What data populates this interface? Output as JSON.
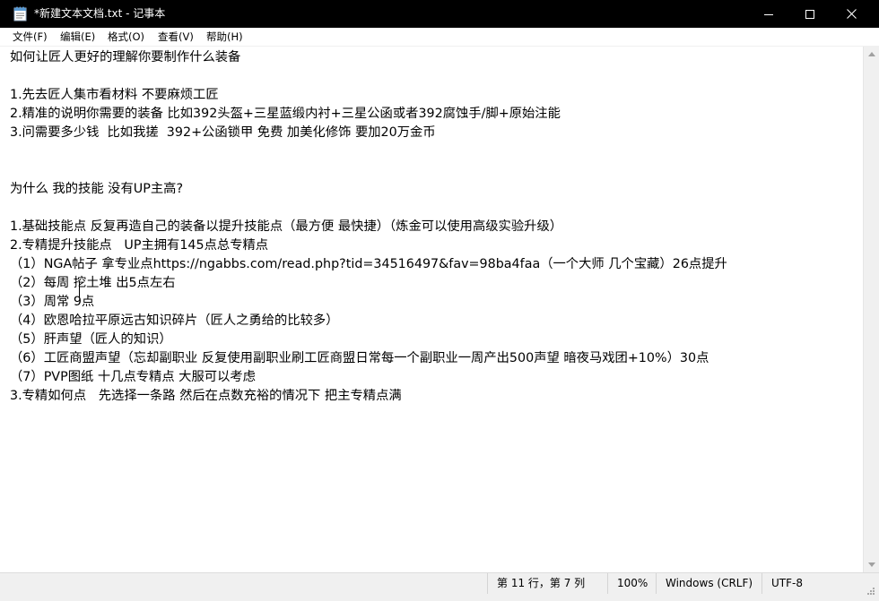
{
  "window": {
    "title": "*新建文本文档.txt - 记事本",
    "icons": {
      "app": "notepad-icon",
      "minimize": "minimize-icon",
      "maximize": "maximize-icon",
      "close": "close-icon"
    }
  },
  "menu": [
    {
      "label": "文件(F)"
    },
    {
      "label": "编辑(E)"
    },
    {
      "label": "格式(O)"
    },
    {
      "label": "查看(V)"
    },
    {
      "label": "帮助(H)"
    }
  ],
  "editor": {
    "lines": [
      "如何让匠人更好的理解你要制作什么装备",
      "",
      "1.先去匠人集市看材料 不要麻烦工匠",
      "2.精准的说明你需要的装备 比如392头盔+三星蓝缎内衬+三星公函或者392腐蚀手/脚+原始注能",
      "3.问需要多少钱  比如我搓  392+公函锁甲 免费 加美化修饰 要加20万金币",
      "",
      "",
      "为什么 我的技能 没有UP主高?",
      "",
      "1.基础技能点 反复再造自己的装备以提升技能点（最方便 最快捷）（炼金可以使用高级实验升级）",
      "2.专精提升技能点   UP主拥有145点总专精点",
      "（1）NGA帖子 拿专业点https://ngabbs.com/read.php?tid=34516497&fav=98ba4faa（一个大师 几个宝藏）26点提升",
      "（2）每周 挖土堆 出5点左右",
      "（3）周常 9点",
      "（4）欧恩哈拉平原远古知识碎片（匠人之勇给的比较多）",
      "（5）肝声望（匠人的知识）",
      "（6）工匠商盟声望（忘却副职业 反复使用副职业刷工匠商盟日常每一个副职业一周产出500声望 暗夜马戏团+10%）30点",
      "（7）PVP图纸 十几点专精点 大服可以考虑",
      "3.专精如何点   先选择一条路 然后在点数充裕的情况下 把主专精点满"
    ]
  },
  "status": {
    "position": "第 11 行，第 7 列",
    "zoom": "100%",
    "line_ending": "Windows (CRLF)",
    "encoding": "UTF-8"
  }
}
